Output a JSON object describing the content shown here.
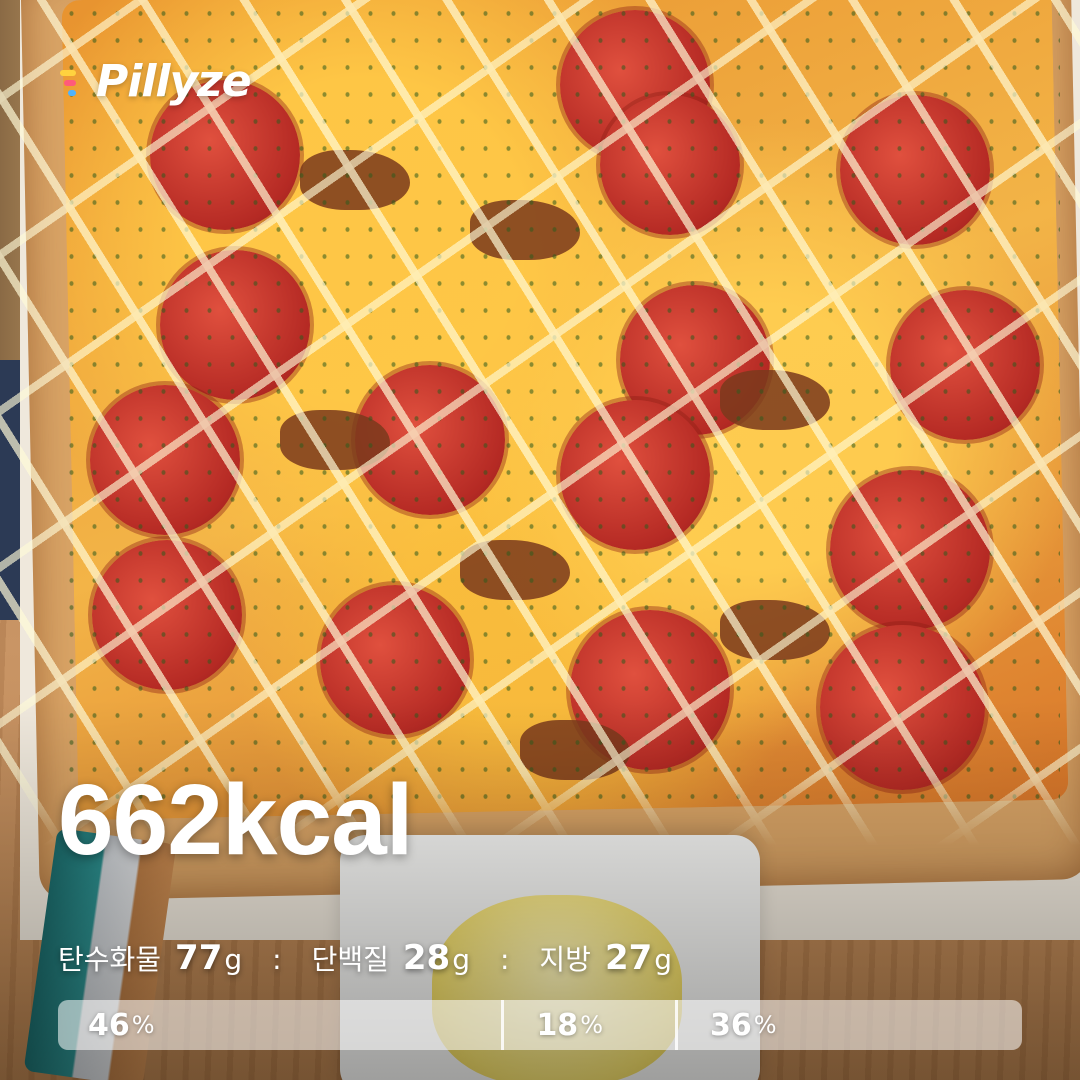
{
  "brand": {
    "name": "Pillyze"
  },
  "calories": {
    "value": "662",
    "unit": "kcal"
  },
  "macros": {
    "separator": ":",
    "carbs": {
      "label": "탄수화물",
      "value": "77",
      "unit": "g",
      "percent": "46",
      "percent_unit": "%",
      "ratio": 0.46
    },
    "protein": {
      "label": "단백질",
      "value": "28",
      "unit": "g",
      "percent": "18",
      "percent_unit": "%",
      "ratio": 0.18
    },
    "fat": {
      "label": "지방",
      "value": "27",
      "unit": "g",
      "percent": "36",
      "percent_unit": "%",
      "ratio": 0.36
    }
  },
  "colors": {
    "text": "#ffffff",
    "logo_accent_1": "#ffd23f",
    "logo_accent_2": "#ff5a7a",
    "logo_accent_3": "#4fb3ff",
    "bar_background": "rgba(255,255,255,0.55)"
  }
}
